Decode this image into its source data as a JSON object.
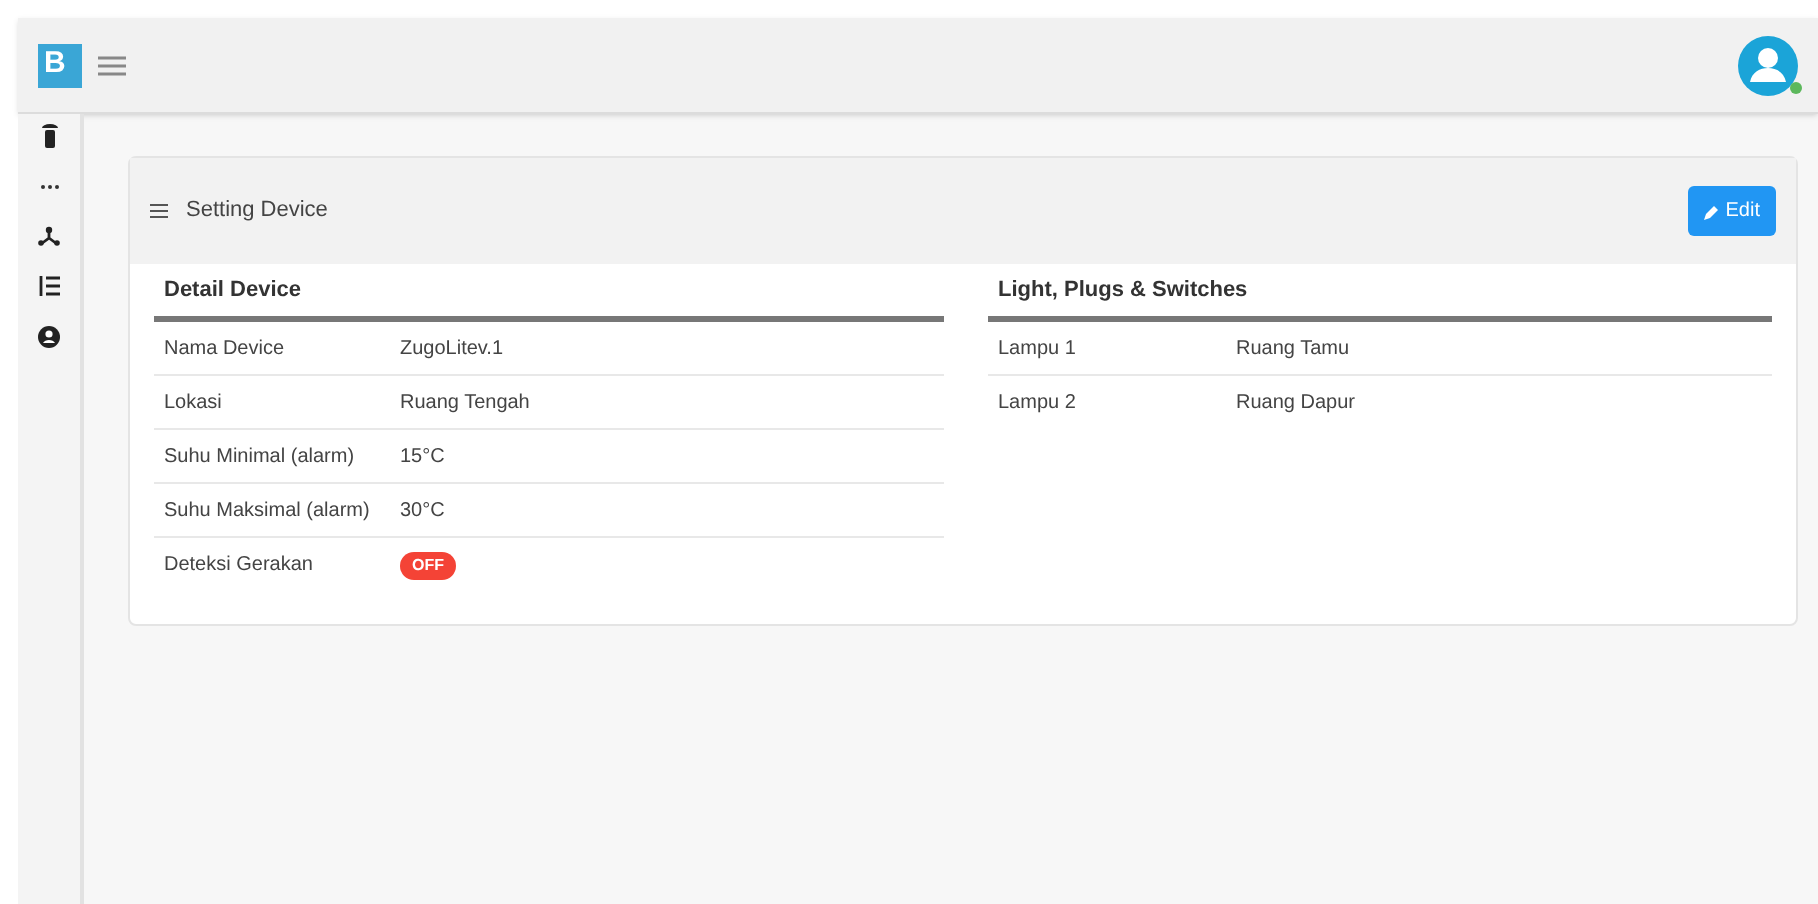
{
  "header": {
    "logo": "B",
    "user": {
      "online": true
    }
  },
  "panel": {
    "title": "Setting Device",
    "button": "Edit"
  },
  "detail": {
    "heading": "Detail Device",
    "rows": [
      {
        "kind": "text",
        "label": "Nama Device",
        "value": "ZugoLitev.1"
      },
      {
        "kind": "text",
        "label": "Lokasi",
        "value": "Ruang Tengah"
      },
      {
        "kind": "text",
        "label": "Suhu Minimal (alarm)",
        "value": "15°C"
      },
      {
        "kind": "text",
        "label": "Suhu Maksimal (alarm)",
        "value": "30°C"
      },
      {
        "kind": "toggle",
        "label": "Deteksi Gerakan",
        "value": "OFF",
        "on": false
      }
    ]
  },
  "lights": {
    "heading": "Light, Plugs & Switches",
    "rows": [
      {
        "label": "Lampu 1",
        "value": "Ruang Tamu"
      },
      {
        "label": "Lampu 2",
        "value": "Ruang Dapur"
      }
    ]
  }
}
